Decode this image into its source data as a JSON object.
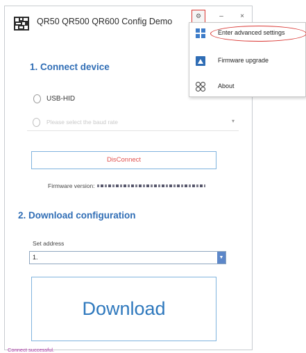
{
  "app": {
    "title": "QR50 QR500 QR600 Config Demo",
    "settings_icon": "gear-icon",
    "minimize_label": "–",
    "close_label": "×"
  },
  "connect": {
    "heading": "1. Connect device",
    "usb_label": "USB-HID",
    "baud_placeholder": "Please select the baud rate",
    "disconnect_label": "DisConnect",
    "firmware_label": "Firmware version:"
  },
  "download": {
    "heading": "2. Download configuration",
    "address_label": "Set address",
    "address_value": "1.",
    "button_label": "Download"
  },
  "status": {
    "text": "Connect successful."
  },
  "menu": {
    "items": [
      {
        "label": "Enter advanced settings",
        "icon": "grid-icon"
      },
      {
        "label": "Firmware upgrade",
        "icon": "upgrade-icon"
      },
      {
        "label": "About",
        "icon": "about-icon"
      }
    ]
  },
  "colors": {
    "accent": "#2f6db5",
    "highlight": "#d9332f",
    "disconnect_text": "#e0524f",
    "status_text": "#b03aa8"
  }
}
